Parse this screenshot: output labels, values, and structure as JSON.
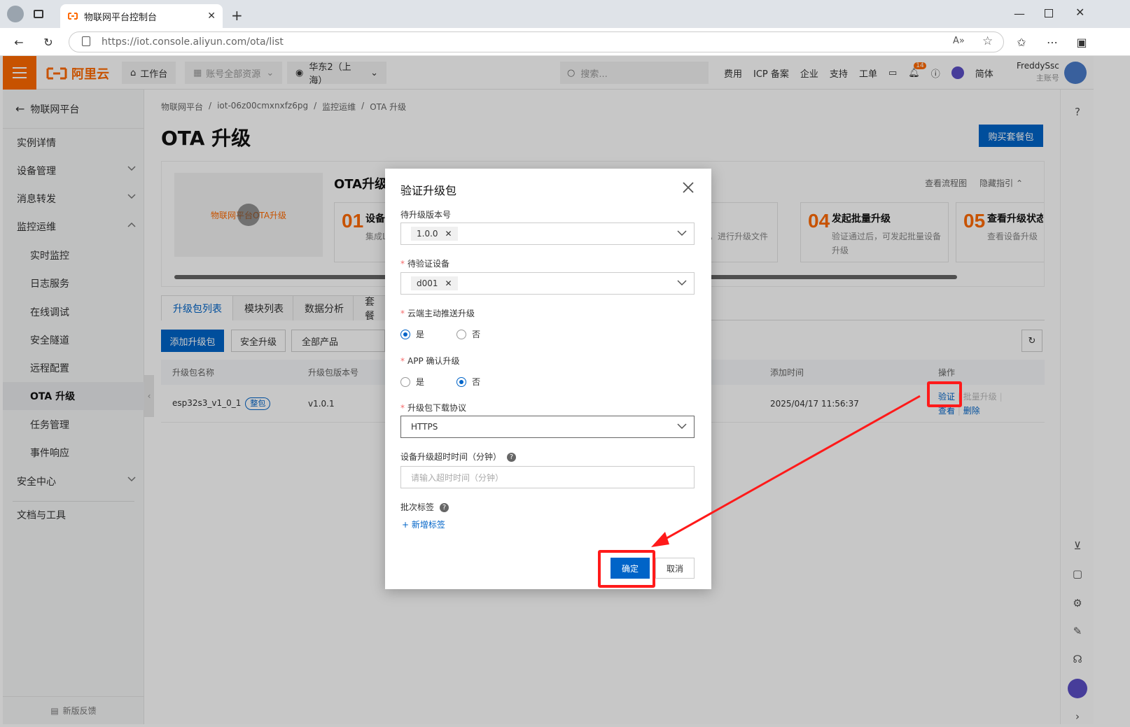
{
  "browser": {
    "tab_title": "物联网平台控制台",
    "url_host": "https://iot.console.aliyun.com",
    "url_path": "/ota/list"
  },
  "topnav": {
    "logo_text": "阿里云",
    "workbench": "工作台",
    "resources": "账号全部资源",
    "region": "华东2（上海）",
    "search_placeholder": "搜索...",
    "links": [
      "费用",
      "ICP 备案",
      "企业",
      "支持",
      "工单"
    ],
    "notify_count": "14",
    "lang": "简体",
    "user_name": "FreddySsc",
    "user_role": "主账号"
  },
  "sidebar": {
    "back_label": "物联网平台",
    "items": [
      {
        "label": "实例详情"
      },
      {
        "label": "设备管理"
      },
      {
        "label": "消息转发"
      },
      {
        "label": "监控运维"
      },
      {
        "label": "实时监控"
      },
      {
        "label": "日志服务"
      },
      {
        "label": "在线调试"
      },
      {
        "label": "安全隧道"
      },
      {
        "label": "远程配置"
      },
      {
        "label": "OTA 升级"
      },
      {
        "label": "任务管理"
      },
      {
        "label": "事件响应"
      },
      {
        "label": "安全中心"
      },
      {
        "label": "文档与工具"
      }
    ],
    "feedback": "新版反馈"
  },
  "breadcrumb": [
    "物联网平台",
    "/",
    "iot-06z00cmxnxfz6pg",
    "/",
    "监控运维",
    "/",
    "OTA 升级"
  ],
  "page_title": "OTA 升级",
  "buy_button": "购买套餐包",
  "guide": {
    "video_text": "物联网平台OTA升级",
    "title": "OTA升级流",
    "view_flow": "查看流程图",
    "hide_guide": "隐藏指引",
    "steps": [
      {
        "num": "01",
        "title": "设备",
        "desc": "集成L 序"
      },
      {
        "num": "04",
        "title": "发起批量升级",
        "desc": "验证通过后，可发起批量设备升级"
      },
      {
        "num": "05",
        "title": "查看升级状态",
        "desc": "查看设备升级"
      }
    ],
    "step3_fragment": "备，进行升级文件"
  },
  "tabs": [
    "升级包列表",
    "模块列表",
    "数据分析",
    "套餐"
  ],
  "buttons": {
    "add": "添加升级包",
    "secure": "安全升级",
    "all_products": "全部产品"
  },
  "table": {
    "headers": [
      "升级包名称",
      "升级包版本号",
      "添加时间",
      "操作"
    ],
    "row": {
      "name": "esp32s3_v1_0_1",
      "tag": "整包",
      "version": "v1.0.1",
      "time": "2025/04/17 11:56:37",
      "act_verify": "验证",
      "act_batch": "批量升级",
      "act_view": "查看",
      "act_delete": "删除"
    }
  },
  "modal": {
    "title": "验证升级包",
    "version_label": "待升级版本号",
    "version_value": "1.0.0",
    "device_label": "待验证设备",
    "device_value": "d001",
    "cloud_push_label": "云端主动推送升级",
    "app_confirm_label": "APP 确认升级",
    "yes": "是",
    "no": "否",
    "protocol_label": "升级包下载协议",
    "protocol_value": "HTTPS",
    "timeout_label": "设备升级超时时间（分钟）",
    "timeout_placeholder": "请输入超时时间（分钟）",
    "batch_tag_label": "批次标签",
    "add_tag": "+ 新增标签",
    "ok": "确定",
    "cancel": "取消",
    "cloud_push_selected": "是",
    "app_confirm_selected": "否"
  },
  "colors": {
    "brand": "#ff6a00",
    "primary": "#0064c8",
    "highlight": "#ff1a1a"
  }
}
